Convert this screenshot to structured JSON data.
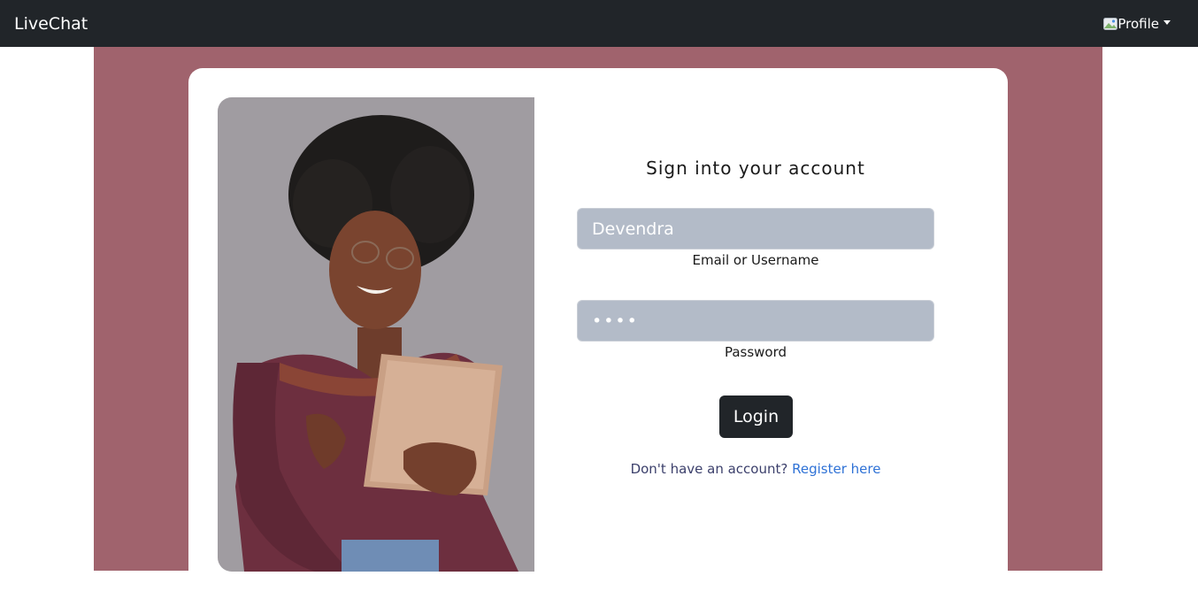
{
  "navbar": {
    "brand": "LiveChat",
    "profile_label": "Profile"
  },
  "login": {
    "title": "Sign into your account",
    "username_value": "Devendra",
    "username_label": "Email or Username",
    "password_value": "••••",
    "password_label": "Password",
    "login_button": "Login",
    "register_prompt": "Don't have an account? ",
    "register_link": "Register here"
  },
  "colors": {
    "navbar_bg": "#212529",
    "section_bg": "#a0636d",
    "input_bg": "#b3bbc8",
    "button_bg": "#212529",
    "link": "#2f72d6"
  }
}
